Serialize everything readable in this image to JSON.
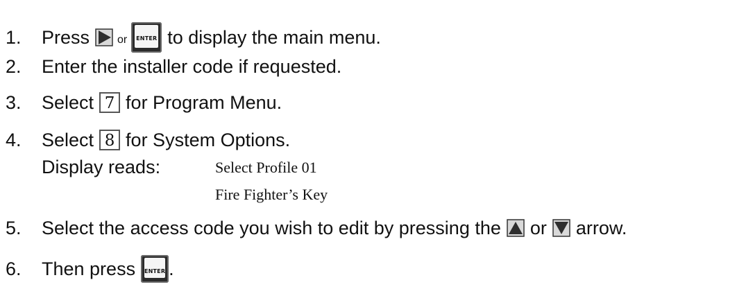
{
  "steps": [
    {
      "num": "1.",
      "pre": "Press",
      "or": "or",
      "post": "to display the main menu.",
      "enter_label": "ENTER"
    },
    {
      "num": "2.",
      "text": "Enter the installer code if requested."
    },
    {
      "num": "3.",
      "pre": "Select",
      "key": "7",
      "post": "for Program Menu."
    },
    {
      "num": "4.",
      "pre": "Select",
      "key": "8",
      "post": "for System Options."
    },
    {
      "num": "5.",
      "pre": "Select the access code you wish to edit by pressing the",
      "or": "or",
      "post": "arrow."
    },
    {
      "num": "6.",
      "pre": "Then press",
      "post": ".",
      "enter_label": "ENTER"
    }
  ],
  "display": {
    "label": "Display reads:",
    "line1": "Select Profile 01",
    "line2": "Fire Fighter’s Key"
  },
  "icons": {
    "right_arrow": "right-triangle-icon",
    "up_arrow": "up-triangle-icon",
    "down_arrow": "down-triangle-icon",
    "enter_key": "enter-key-icon"
  },
  "colors": {
    "key_dark": "#2b2b2b",
    "arrow_fill": "#2f2f2f"
  }
}
